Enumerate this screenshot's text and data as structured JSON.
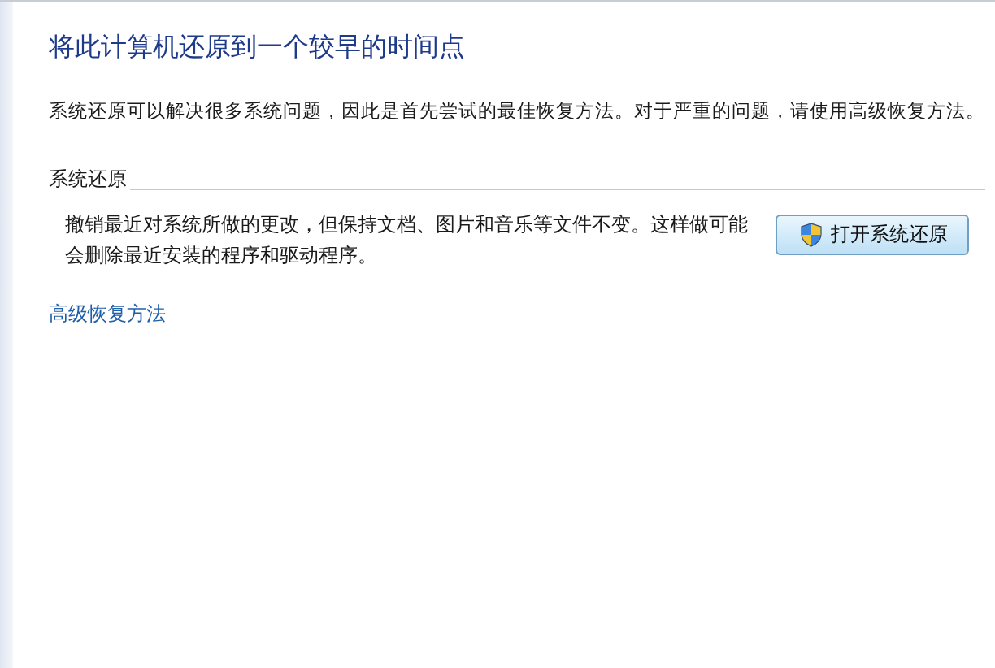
{
  "title": "将此计算机还原到一个较早的时间点",
  "description": "系统还原可以解决很多系统问题，因此是首先尝试的最佳恢复方法。对于严重的问题，请使用高级恢复方法。",
  "section": {
    "heading": "系统还原",
    "text": "撤销最近对系统所做的更改，但保持文档、图片和音乐等文件不变。这样做可能会删除最近安装的程序和驱动程序。",
    "button": "打开系统还原"
  },
  "link": "高级恢复方法"
}
